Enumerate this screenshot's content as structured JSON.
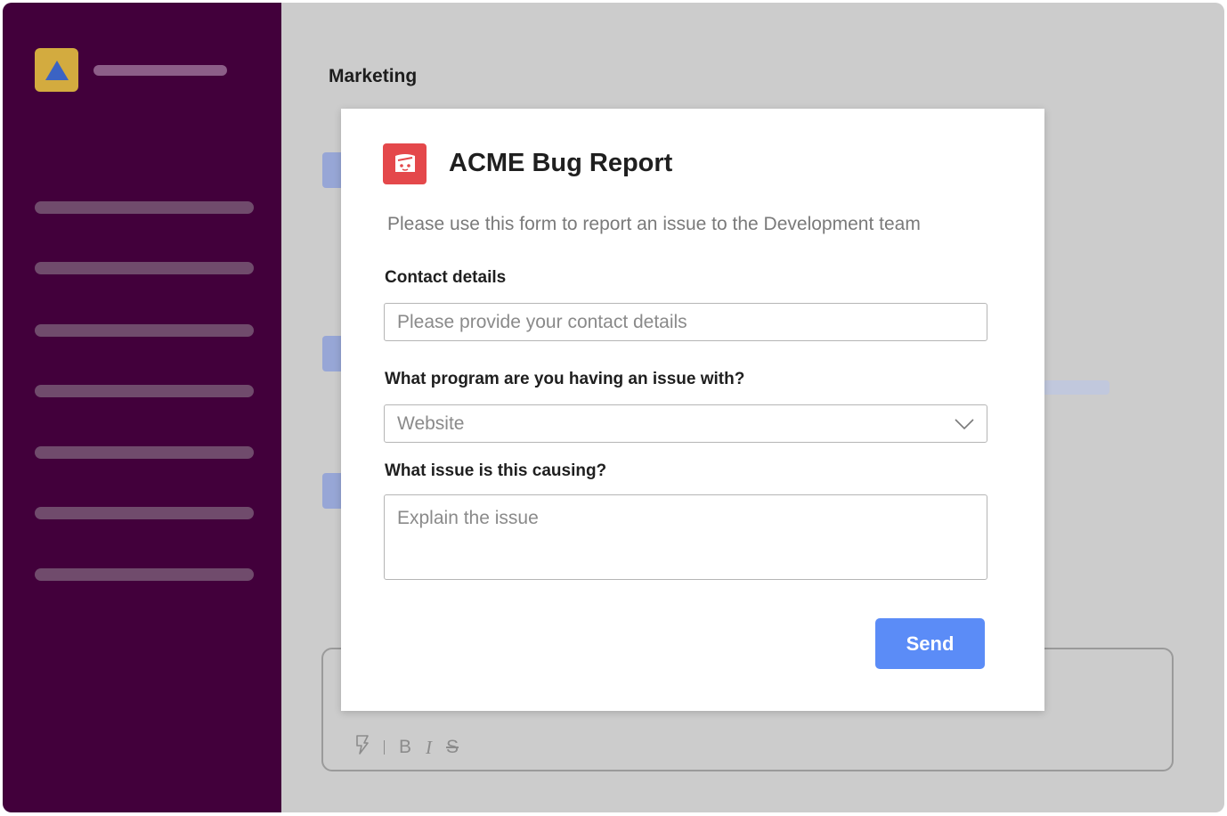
{
  "channel": {
    "title": "Marketing"
  },
  "modal": {
    "icon": "bug-report-app-icon",
    "title": "ACME Bug Report",
    "description": "Please use this form to report an issue to the Development team",
    "contact": {
      "label": "Contact details",
      "placeholder": "Please provide your contact details",
      "value": ""
    },
    "program": {
      "label": "What program are you having an issue with?",
      "selected": "Website",
      "icon": "chevron-down-icon"
    },
    "issue": {
      "label": "What issue is this causing?",
      "placeholder": "Explain the issue",
      "value": ""
    },
    "send_label": "Send"
  },
  "composer": {
    "toolbar": [
      "lightning-bolt-icon",
      "bold-icon",
      "italic-icon",
      "strikethrough-icon"
    ],
    "bold_glyph": "B",
    "italic_glyph": "I",
    "strike_glyph": "S"
  },
  "colors": {
    "sidebar": "#42003b",
    "logo": "#d3ab3f",
    "logo_triangle": "#3b63c4",
    "app_icon": "#e4484b",
    "send_button": "#5b8cf7"
  }
}
